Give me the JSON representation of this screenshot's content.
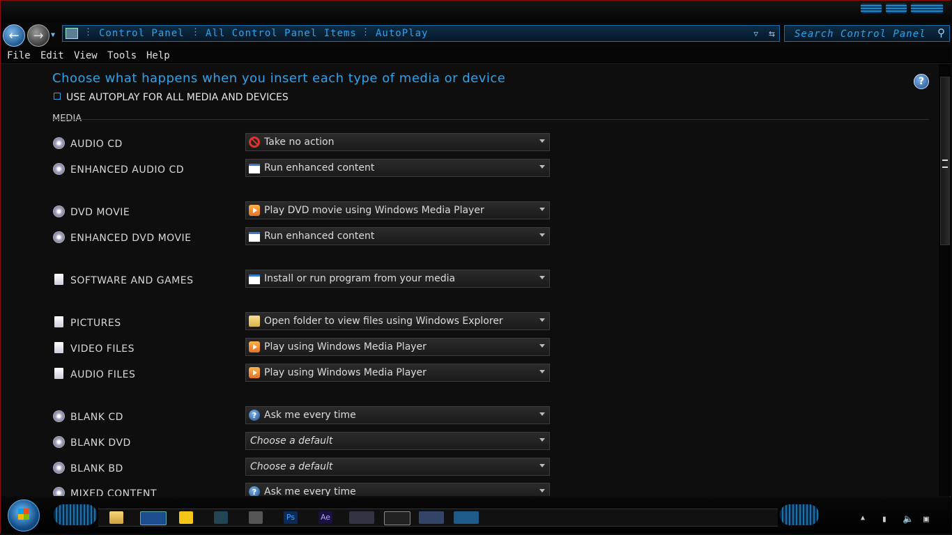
{
  "breadcrumbs": [
    "Control Panel",
    "All Control Panel Items",
    "AutoPlay"
  ],
  "search": {
    "placeholder": "Search Control Panel"
  },
  "menu": [
    "File",
    "Edit",
    "View",
    "Tools",
    "Help"
  ],
  "heading": "Choose what happens when you insert each type of media or device",
  "use_autoplay_label": "USE AUTOPLAY FOR ALL MEDIA AND DEVICES",
  "section_label": "MEDIA",
  "help_glyph": "?",
  "rows": [
    {
      "label": "AUDIO CD",
      "value": "Take no action",
      "icon": "no-action-icon"
    },
    {
      "label": "ENHANCED AUDIO CD",
      "value": "Run enhanced content",
      "icon": "window-icon"
    },
    {
      "label": "DVD MOVIE",
      "value": "Play DVD movie using Windows Media Player",
      "icon": "wmp-icon"
    },
    {
      "label": "ENHANCED DVD MOVIE",
      "value": "Run enhanced content",
      "icon": "window-icon"
    },
    {
      "label": "SOFTWARE AND GAMES",
      "value": "Install or run program from your media",
      "icon": "window-icon"
    },
    {
      "label": "PICTURES",
      "value": "Open folder to view files using Windows Explorer",
      "icon": "folder-icon"
    },
    {
      "label": "VIDEO FILES",
      "value": "Play using Windows Media Player",
      "icon": "wmp-icon"
    },
    {
      "label": "AUDIO FILES",
      "value": "Play using Windows Media Player",
      "icon": "wmp-icon"
    },
    {
      "label": "BLANK CD",
      "value": "Ask me every time",
      "icon": "ask-icon"
    },
    {
      "label": "BLANK DVD",
      "value": "Choose a default",
      "icon": ""
    },
    {
      "label": "BLANK BD",
      "value": "Choose a default",
      "icon": ""
    },
    {
      "label": "MIXED CONTENT",
      "value": "Ask me every time",
      "icon": "ask-icon"
    }
  ],
  "taskbar_apps": [
    "Ps",
    "Ae"
  ]
}
